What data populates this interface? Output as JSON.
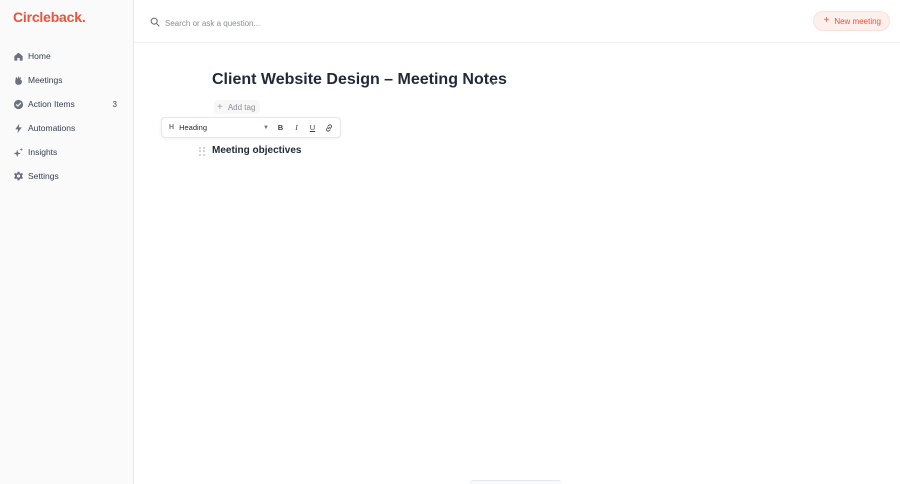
{
  "brand": {
    "name": "Circleback",
    "dot": ".",
    "color": "#e8533d"
  },
  "sidebar": {
    "items": [
      {
        "label": "Home",
        "icon": "home-icon"
      },
      {
        "label": "Meetings",
        "icon": "meetings-icon"
      },
      {
        "label": "Action Items",
        "icon": "check-circle-icon",
        "badge": "3"
      },
      {
        "label": "Automations",
        "icon": "lightning-icon"
      },
      {
        "label": "Insights",
        "icon": "sparkle-icon"
      },
      {
        "label": "Settings",
        "icon": "gear-icon"
      }
    ]
  },
  "search": {
    "placeholder": "Search or ask a question...",
    "icon": "search-icon"
  },
  "header": {
    "new_meeting_label": "New meeting"
  },
  "document": {
    "title": "Client Website Design – Meeting Notes",
    "add_tag_label": "Add tag",
    "toolbar": {
      "block_type": "Heading",
      "block_type_icon": "H",
      "bold": "B",
      "italic": "I",
      "underline": "U"
    },
    "blocks": [
      {
        "type": "heading",
        "text": "Meeting objectives"
      }
    ]
  },
  "colors": {
    "accent": "#e8533d",
    "accent_bg": "#fdf0ec",
    "text": "#1f2937",
    "muted": "#8a8f98"
  }
}
